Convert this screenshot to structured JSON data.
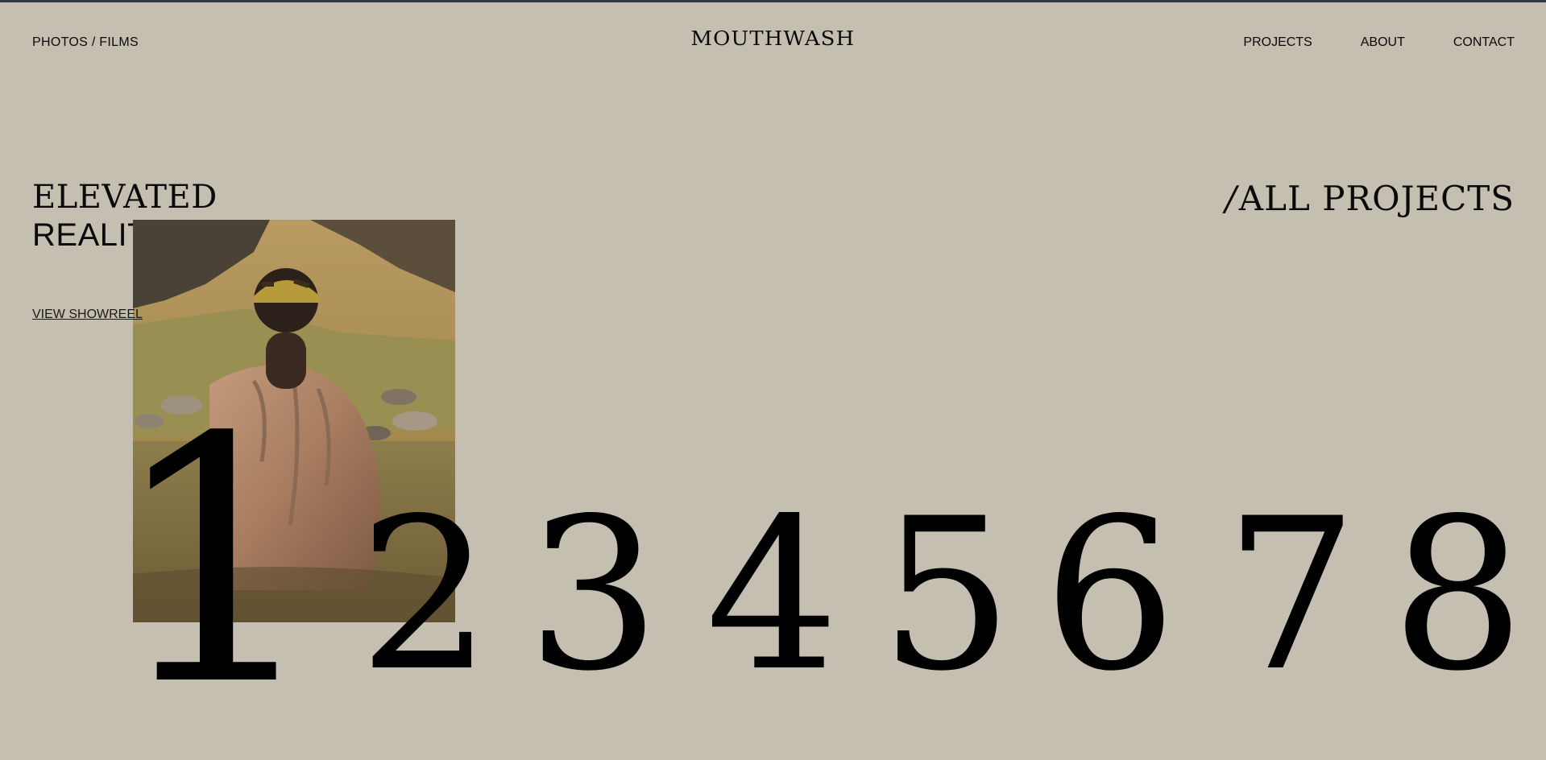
{
  "header": {
    "left_link": "PHOTOS / FILMS",
    "logo": "MOUTHWASH",
    "nav": [
      "PROJECTS",
      "ABOUT",
      "CONTACT"
    ]
  },
  "hero": {
    "headline_line1": "ELEVATED",
    "headline_line2": "REALITY",
    "showreel_link": "VIEW SHOWREEL",
    "all_projects_slash": "/",
    "all_projects_label": "ALL PROJECTS"
  },
  "projects": {
    "numbers": [
      "1",
      "2",
      "3",
      "4",
      "5",
      "6",
      "7",
      "8"
    ],
    "featured_photo": "man-in-river-photo"
  },
  "colors": {
    "background": "#c5bfb1",
    "text": "#0a0a0a",
    "top_border": "#2f3a4c"
  }
}
